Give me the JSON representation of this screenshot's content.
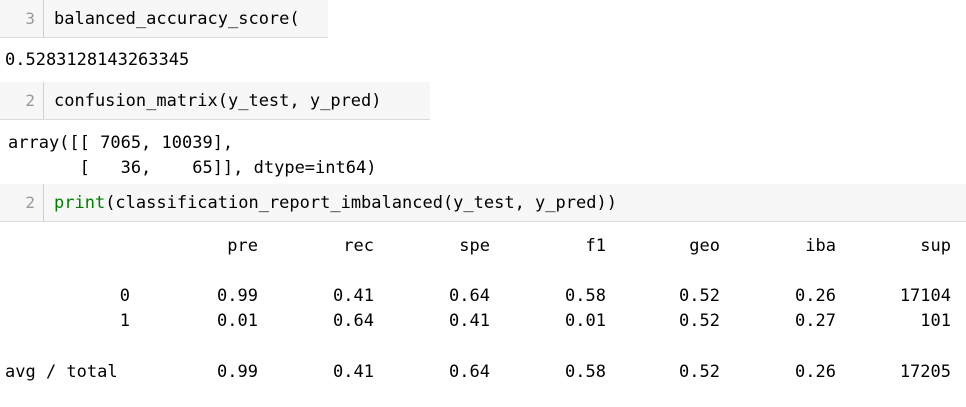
{
  "cells": [
    {
      "line_number": "3",
      "code": "balanced_accuracy_score(",
      "output": "0.5283128143263345"
    },
    {
      "line_number": "2",
      "code": "confusion_matrix(y_test, y_pred)",
      "output_lines": [
        "array([[ 7065, 10039],",
        "       [   36,    65]], dtype=int64)"
      ]
    },
    {
      "line_number": "2",
      "code_keyword": "print",
      "code_rest": "(classification_report_imbalanced(y_test, y_pred))"
    }
  ],
  "report": {
    "headers": [
      "pre",
      "rec",
      "spe",
      "f1",
      "geo",
      "iba",
      "sup"
    ],
    "rows": [
      {
        "label": "0",
        "values": [
          "0.99",
          "0.41",
          "0.64",
          "0.58",
          "0.52",
          "0.26",
          "17104"
        ]
      },
      {
        "label": "1",
        "values": [
          "0.01",
          "0.64",
          "0.41",
          "0.01",
          "0.52",
          "0.27",
          "101"
        ]
      },
      {
        "label": "avg / total",
        "values": [
          "0.99",
          "0.41",
          "0.64",
          "0.58",
          "0.52",
          "0.26",
          "17205"
        ]
      }
    ]
  }
}
